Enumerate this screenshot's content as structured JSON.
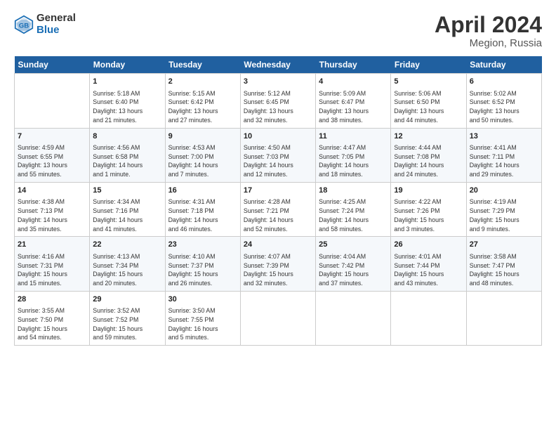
{
  "header": {
    "logo_general": "General",
    "logo_blue": "Blue",
    "title": "April 2024",
    "subtitle": "Megion, Russia"
  },
  "days_of_week": [
    "Sunday",
    "Monday",
    "Tuesday",
    "Wednesday",
    "Thursday",
    "Friday",
    "Saturday"
  ],
  "weeks": [
    [
      {
        "num": "",
        "info": ""
      },
      {
        "num": "1",
        "info": "Sunrise: 5:18 AM\nSunset: 6:40 PM\nDaylight: 13 hours\nand 21 minutes."
      },
      {
        "num": "2",
        "info": "Sunrise: 5:15 AM\nSunset: 6:42 PM\nDaylight: 13 hours\nand 27 minutes."
      },
      {
        "num": "3",
        "info": "Sunrise: 5:12 AM\nSunset: 6:45 PM\nDaylight: 13 hours\nand 32 minutes."
      },
      {
        "num": "4",
        "info": "Sunrise: 5:09 AM\nSunset: 6:47 PM\nDaylight: 13 hours\nand 38 minutes."
      },
      {
        "num": "5",
        "info": "Sunrise: 5:06 AM\nSunset: 6:50 PM\nDaylight: 13 hours\nand 44 minutes."
      },
      {
        "num": "6",
        "info": "Sunrise: 5:02 AM\nSunset: 6:52 PM\nDaylight: 13 hours\nand 50 minutes."
      }
    ],
    [
      {
        "num": "7",
        "info": "Sunrise: 4:59 AM\nSunset: 6:55 PM\nDaylight: 13 hours\nand 55 minutes."
      },
      {
        "num": "8",
        "info": "Sunrise: 4:56 AM\nSunset: 6:58 PM\nDaylight: 14 hours\nand 1 minute."
      },
      {
        "num": "9",
        "info": "Sunrise: 4:53 AM\nSunset: 7:00 PM\nDaylight: 14 hours\nand 7 minutes."
      },
      {
        "num": "10",
        "info": "Sunrise: 4:50 AM\nSunset: 7:03 PM\nDaylight: 14 hours\nand 12 minutes."
      },
      {
        "num": "11",
        "info": "Sunrise: 4:47 AM\nSunset: 7:05 PM\nDaylight: 14 hours\nand 18 minutes."
      },
      {
        "num": "12",
        "info": "Sunrise: 4:44 AM\nSunset: 7:08 PM\nDaylight: 14 hours\nand 24 minutes."
      },
      {
        "num": "13",
        "info": "Sunrise: 4:41 AM\nSunset: 7:11 PM\nDaylight: 14 hours\nand 29 minutes."
      }
    ],
    [
      {
        "num": "14",
        "info": "Sunrise: 4:38 AM\nSunset: 7:13 PM\nDaylight: 14 hours\nand 35 minutes."
      },
      {
        "num": "15",
        "info": "Sunrise: 4:34 AM\nSunset: 7:16 PM\nDaylight: 14 hours\nand 41 minutes."
      },
      {
        "num": "16",
        "info": "Sunrise: 4:31 AM\nSunset: 7:18 PM\nDaylight: 14 hours\nand 46 minutes."
      },
      {
        "num": "17",
        "info": "Sunrise: 4:28 AM\nSunset: 7:21 PM\nDaylight: 14 hours\nand 52 minutes."
      },
      {
        "num": "18",
        "info": "Sunrise: 4:25 AM\nSunset: 7:24 PM\nDaylight: 14 hours\nand 58 minutes."
      },
      {
        "num": "19",
        "info": "Sunrise: 4:22 AM\nSunset: 7:26 PM\nDaylight: 15 hours\nand 3 minutes."
      },
      {
        "num": "20",
        "info": "Sunrise: 4:19 AM\nSunset: 7:29 PM\nDaylight: 15 hours\nand 9 minutes."
      }
    ],
    [
      {
        "num": "21",
        "info": "Sunrise: 4:16 AM\nSunset: 7:31 PM\nDaylight: 15 hours\nand 15 minutes."
      },
      {
        "num": "22",
        "info": "Sunrise: 4:13 AM\nSunset: 7:34 PM\nDaylight: 15 hours\nand 20 minutes."
      },
      {
        "num": "23",
        "info": "Sunrise: 4:10 AM\nSunset: 7:37 PM\nDaylight: 15 hours\nand 26 minutes."
      },
      {
        "num": "24",
        "info": "Sunrise: 4:07 AM\nSunset: 7:39 PM\nDaylight: 15 hours\nand 32 minutes."
      },
      {
        "num": "25",
        "info": "Sunrise: 4:04 AM\nSunset: 7:42 PM\nDaylight: 15 hours\nand 37 minutes."
      },
      {
        "num": "26",
        "info": "Sunrise: 4:01 AM\nSunset: 7:44 PM\nDaylight: 15 hours\nand 43 minutes."
      },
      {
        "num": "27",
        "info": "Sunrise: 3:58 AM\nSunset: 7:47 PM\nDaylight: 15 hours\nand 48 minutes."
      }
    ],
    [
      {
        "num": "28",
        "info": "Sunrise: 3:55 AM\nSunset: 7:50 PM\nDaylight: 15 hours\nand 54 minutes."
      },
      {
        "num": "29",
        "info": "Sunrise: 3:52 AM\nSunset: 7:52 PM\nDaylight: 15 hours\nand 59 minutes."
      },
      {
        "num": "30",
        "info": "Sunrise: 3:50 AM\nSunset: 7:55 PM\nDaylight: 16 hours\nand 5 minutes."
      },
      {
        "num": "",
        "info": ""
      },
      {
        "num": "",
        "info": ""
      },
      {
        "num": "",
        "info": ""
      },
      {
        "num": "",
        "info": ""
      }
    ]
  ]
}
